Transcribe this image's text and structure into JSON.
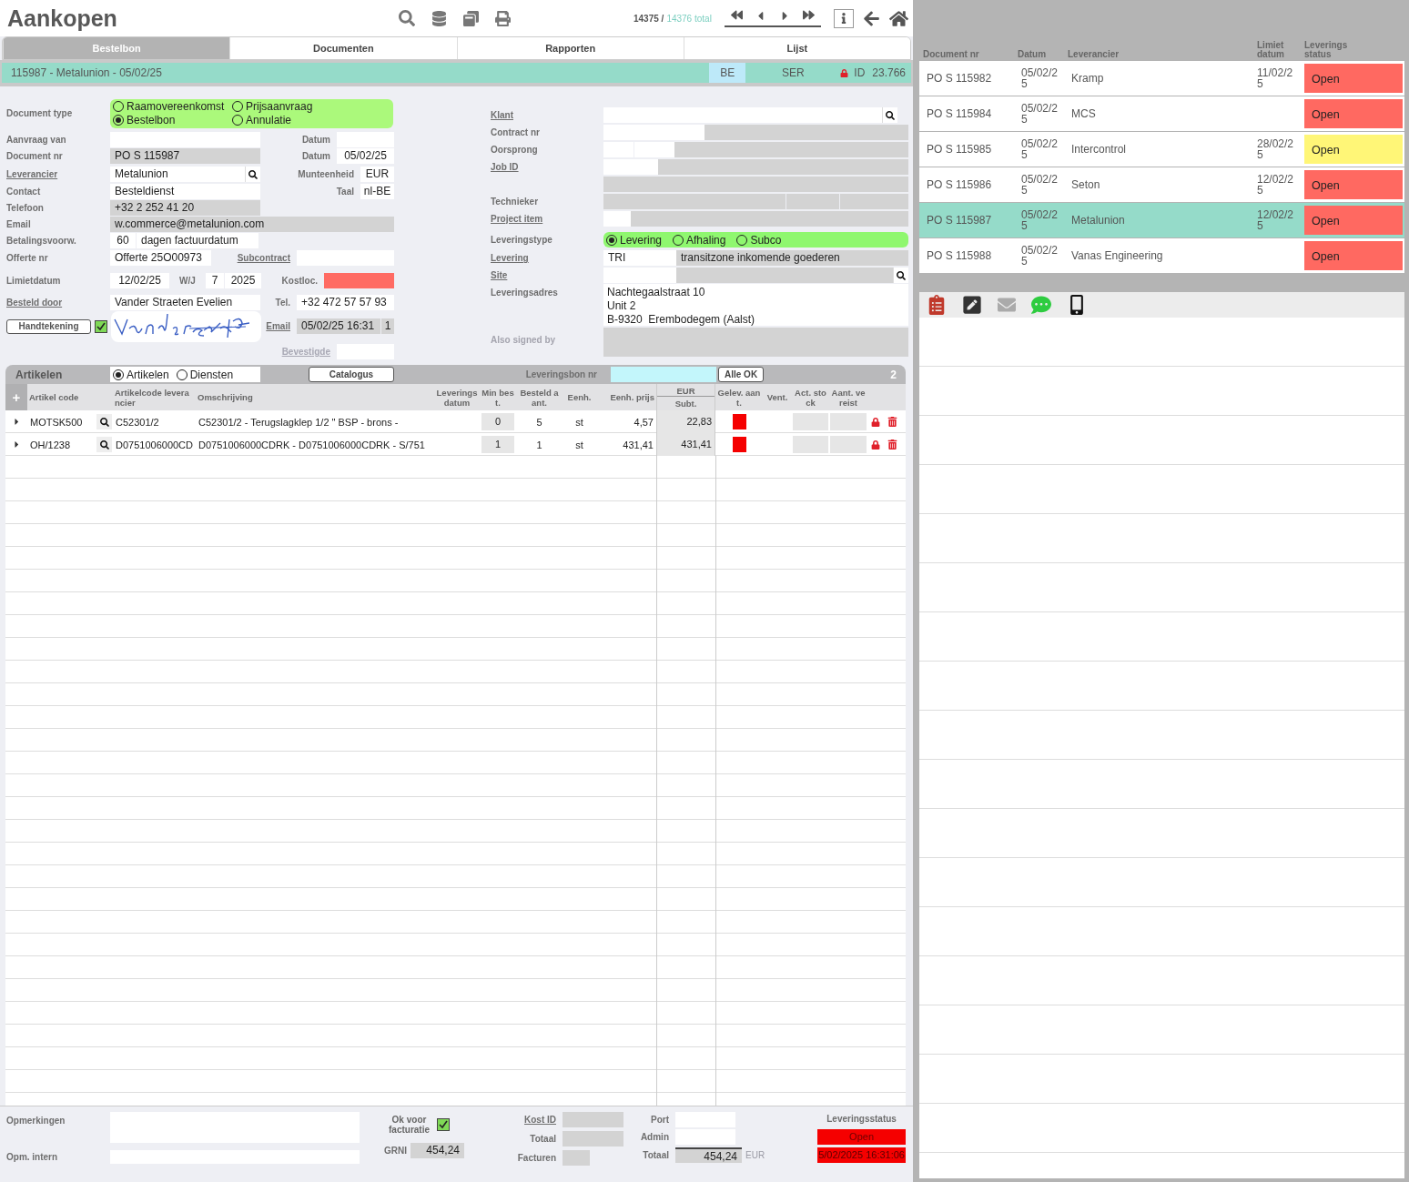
{
  "app": {
    "title": "Aankopen"
  },
  "navigator": {
    "position": "14375 /",
    "total": "14376 total"
  },
  "tabs": [
    {
      "label": "Bestelbon",
      "selected": true
    },
    {
      "label": "Documenten",
      "selected": false
    },
    {
      "label": "Rapporten",
      "selected": false
    },
    {
      "label": "Lijst",
      "selected": false
    }
  ],
  "record": {
    "title": "115987 - Metalunion - 05/02/25",
    "country": "BE",
    "series": "SER",
    "locked": true,
    "id_label": "ID",
    "id": "23.766"
  },
  "form_left": {
    "doc_type": {
      "label": "Document type",
      "options": [
        {
          "label": "Raamovereenkomst",
          "selected": false
        },
        {
          "label": "Prijsaanvraag",
          "selected": false
        },
        {
          "label": "Bestelbon",
          "selected": true
        },
        {
          "label": "Annulatie",
          "selected": false
        }
      ]
    },
    "aanvraag_van": {
      "label": "Aanvraag van"
    },
    "aanvraag_datum": {
      "label": "Datum"
    },
    "document_nr": {
      "label": "Document nr",
      "value": "PO S 115987",
      "readonly": true
    },
    "document_datum": {
      "label": "Datum",
      "value": "05/02/25"
    },
    "leverancier": {
      "label": "Leverancier",
      "link": true,
      "value": "Metalunion"
    },
    "munteenheid": {
      "label": "Munteenheid",
      "value": "EUR"
    },
    "contact": {
      "label": "Contact",
      "value": "Besteldienst"
    },
    "taal": {
      "label": "Taal",
      "value": "nl-BE"
    },
    "telefoon": {
      "label": "Telefoon",
      "value": "+32 2 252 41 20",
      "readonly": true
    },
    "email": {
      "label": "Email",
      "value": "w.commerce@metalunion.com",
      "readonly": true
    },
    "betalingsvoorwaarden": {
      "label": "Betalingsvoorw.",
      "days": "60",
      "terms": "dagen factuurdatum"
    },
    "offerte_nr": {
      "label": "Offerte nr",
      "value": "Offerte 25O00973"
    },
    "subcontract": {
      "label": "Subcontract",
      "link": true
    },
    "limietdatum": {
      "label": "Limietdatum",
      "value": "12/02/25"
    },
    "week_jaar": {
      "label": "W/J",
      "week": "7",
      "year": "2025"
    },
    "kostloc": {
      "label": "Kostloc.",
      "invalid": true
    },
    "besteld_door": {
      "label": "Besteld door",
      "link": true,
      "value": "Vander Straeten Evelien"
    },
    "tel": {
      "label": "Tel.",
      "value": "+32 472 57 57 93"
    },
    "signature": {
      "button": "Handtekening",
      "signed": true
    },
    "email_sent": {
      "label": "Email",
      "link": true,
      "value": "05/02/25 16:31",
      "count": "1",
      "readonly": true
    },
    "bevestigde": {
      "label": "Bevestigde",
      "link": true,
      "disabled": true
    }
  },
  "form_right": {
    "klant": {
      "label": "Klant",
      "link": true
    },
    "contract_nr": {
      "label": "Contract nr"
    },
    "oorsprong": {
      "label": "Oorsprong"
    },
    "job_id": {
      "label": "Job ID",
      "link": true
    },
    "technieker": {
      "label": "Technieker"
    },
    "project_item": {
      "label": "Project item",
      "link": true
    },
    "leveringstype": {
      "label": "Leveringstype",
      "options": [
        {
          "label": "Levering",
          "selected": true
        },
        {
          "label": "Afhaling",
          "selected": false
        },
        {
          "label": "Subco",
          "selected": false
        }
      ]
    },
    "levering": {
      "label": "Levering",
      "link": true,
      "code": "TRI",
      "description": "transitzone inkomende goederen"
    },
    "site": {
      "label": "Site",
      "link": true
    },
    "leveringsadres": {
      "label": "Leveringsadres",
      "lines": [
        "Nachtegaalstraat 10",
        "Unit 2",
        "B-9320  Erembodegem (Aalst)"
      ]
    },
    "also_signed": {
      "label": "Also signed by"
    }
  },
  "articles": {
    "title": "Artikelen",
    "filter": [
      {
        "label": "Artikelen",
        "selected": true
      },
      {
        "label": "Diensten",
        "selected": false
      }
    ],
    "catalog_button": "Catalogus",
    "delivery_note_label": "Leveringsbon nr",
    "all_ok_button": "Alle OK",
    "count": "2",
    "add_button": "+",
    "columns": [
      {
        "label": "Artikel code"
      },
      {
        "label": "Artikelcode leverancier"
      },
      {
        "label": "Omschrijving"
      },
      {
        "label": "Leveringsdatum"
      },
      {
        "label": "Min best."
      },
      {
        "label": "Besteld aant."
      },
      {
        "label": "Eenh."
      },
      {
        "label": "Eenh. prijs"
      },
      {
        "label": "Subt.",
        "group": "EUR"
      },
      {
        "label": "Gelev. aant."
      },
      {
        "label": "Vent."
      },
      {
        "label": "Act. stock"
      },
      {
        "label": "Aant. vereist"
      }
    ],
    "rows": [
      {
        "code": "MOTSK500",
        "supplier_code": "C52301/2",
        "description": "C52301/2 - Terugslagklep 1/2 \" BSP - brons -",
        "min": "0",
        "ordered": "5",
        "unit": "st",
        "price": "4,57",
        "subtotal": "22,83",
        "delivered": false,
        "locked": true
      },
      {
        "code": "OH/1238",
        "supplier_code": "D0751006000CD",
        "description": "D0751006000CDRK - D0751006000CDRK - S/751",
        "min": "1",
        "ordered": "1",
        "unit": "st",
        "price": "431,41",
        "subtotal": "431,41",
        "delivered": false,
        "locked": true
      }
    ]
  },
  "footer": {
    "opmerkingen": {
      "label": "Opmerkingen"
    },
    "opm_intern": {
      "label": "Opm. intern"
    },
    "invoice_ok": {
      "label": "Ok voor facturatie",
      "checked": true
    },
    "grni": {
      "label": "GRNI",
      "value": "454,24"
    },
    "kost_id": {
      "label": "Kost ID",
      "link": true
    },
    "kost_totaal": {
      "label": "Totaal"
    },
    "facturen": {
      "label": "Facturen"
    },
    "port": {
      "label": "Port"
    },
    "admin": {
      "label": "Admin"
    },
    "totaal": {
      "label": "Totaal",
      "value": "454,24",
      "currency": "EUR"
    },
    "delivery_status": {
      "label": "Leveringsstatus",
      "value": "Open",
      "timestamp": "5/02/2025 16:31:06"
    }
  },
  "list": {
    "columns": [
      "Document nr",
      "Datum",
      "Leverancier",
      "Limiet datum",
      "Leverings status"
    ],
    "rows": [
      {
        "document": "PO S 115982",
        "date": "05/02/25",
        "supplier": "Kramp",
        "limit": "11/02/25",
        "status": "Open",
        "color": "#ff6961",
        "selected": false
      },
      {
        "document": "PO S 115984",
        "date": "05/02/25",
        "supplier": "MCS",
        "status": "Open",
        "color": "#ff6961",
        "selected": false
      },
      {
        "document": "PO S 115985",
        "date": "05/02/25",
        "supplier": "Intercontrol",
        "limit": "28/02/25",
        "status": "Open",
        "color": "#fff677",
        "selected": false
      },
      {
        "document": "PO S 115986",
        "date": "05/02/25",
        "supplier": "Seton",
        "limit": "12/02/25",
        "status": "Open",
        "color": "#ff6961",
        "selected": false
      },
      {
        "document": "PO S 115987",
        "date": "05/02/25",
        "supplier": "Metalunion",
        "limit": "12/02/25",
        "status": "Open",
        "color": "#ff6961",
        "selected": true
      },
      {
        "document": "PO S 115988",
        "date": "05/02/25",
        "supplier": "Vanas Engineering",
        "status": "Open",
        "color": "#ff6961",
        "selected": false
      }
    ]
  }
}
